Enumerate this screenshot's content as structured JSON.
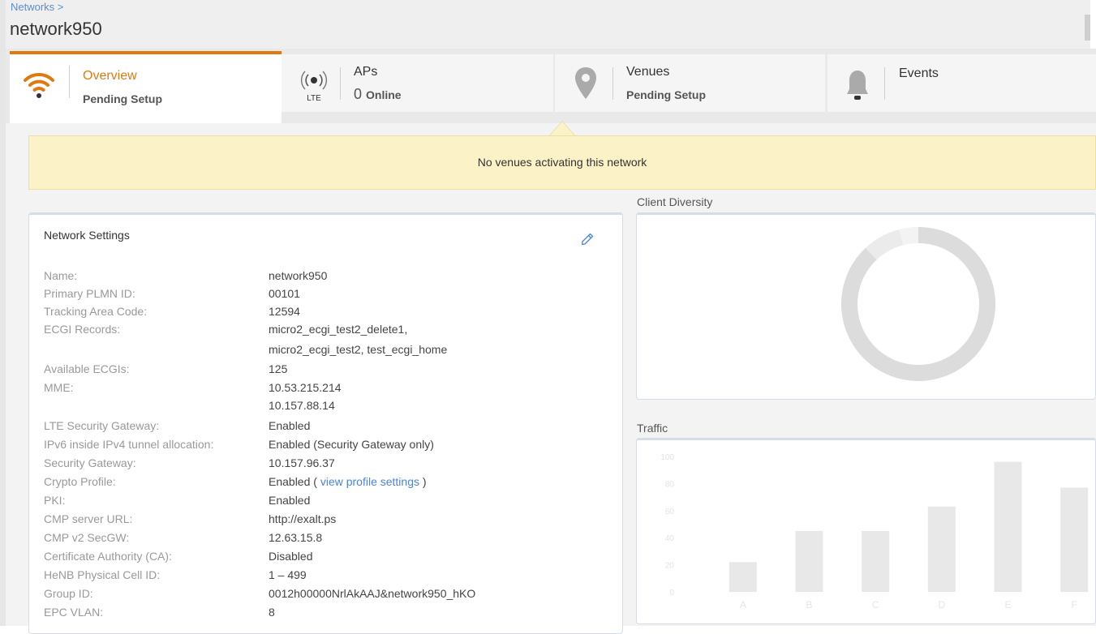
{
  "header": {
    "breadcrumb": "Networks >",
    "title": "network950"
  },
  "tabs": [
    {
      "label": "Overview",
      "sub": "Pending Setup",
      "icon": "wifi-icon",
      "active": true
    },
    {
      "label": "APs",
      "count": "0",
      "count_suffix": "Online",
      "icon": "lte-ap-icon",
      "icon_text": "LTE"
    },
    {
      "label": "Venues",
      "sub": "Pending Setup",
      "icon": "location-pin-icon"
    },
    {
      "label": "Events",
      "icon": "bell-icon"
    }
  ],
  "banner": {
    "text": "No venues activating this network"
  },
  "settings": {
    "title": "Network Settings",
    "rows": [
      {
        "label": "Name:",
        "value": "network950"
      },
      {
        "label": "Primary PLMN ID:",
        "value": "00101"
      },
      {
        "label": "Tracking Area Code:",
        "value": "12594"
      },
      {
        "label": "ECGI Records:",
        "value": "micro2_ecgi_test2_delete1,",
        "value2": "micro2_ecgi_test2, test_ecgi_home"
      },
      {
        "label": "Available ECGIs:",
        "value": "125"
      },
      {
        "label": "MME:",
        "value": "10.53.215.214",
        "value2": "10.157.88.14"
      },
      {
        "label": "LTE Security Gateway:",
        "value": "Enabled"
      },
      {
        "label": "IPv6 inside IPv4 tunnel allocation:",
        "value": "Enabled (Security Gateway only)"
      },
      {
        "label": "Security Gateway:",
        "value": "10.157.96.37"
      },
      {
        "label": "Crypto Profile:",
        "value": "Enabled (",
        "link": "view profile settings",
        "value_after": ")"
      },
      {
        "label": "PKI:",
        "value": "Enabled"
      },
      {
        "label": "CMP server URL:",
        "value": "http://exalt.ps"
      },
      {
        "label": "CMP v2 SecGW:",
        "value": "12.63.15.8"
      },
      {
        "label": "Certificate Authority (CA):",
        "value": "Disabled"
      },
      {
        "label": "HeNB Physical Cell ID:",
        "value": "1 – 499"
      },
      {
        "label": "Group ID:",
        "value": "0012h00000NrlAkAAJ&network950_hKO"
      },
      {
        "label": "EPC VLAN:",
        "value": "8"
      }
    ]
  },
  "client_diversity": {
    "title": "Client Diversity"
  },
  "traffic": {
    "title": "Traffic"
  },
  "chart_data": [
    {
      "type": "pie",
      "title": "Client Diversity",
      "values": [
        88,
        8,
        4
      ],
      "colors": [
        "#dcdcdc",
        "#ebebeb",
        "#f3f3f3"
      ]
    },
    {
      "type": "bar",
      "title": "Traffic",
      "categories": [
        "A",
        "B",
        "C",
        "D",
        "E",
        "F"
      ],
      "values": [
        22,
        45,
        45,
        63,
        96,
        77
      ],
      "ylim": [
        0,
        100
      ],
      "yticks": [
        "0",
        "20",
        "40",
        "60",
        "80",
        "100"
      ],
      "color": "#e8e8e8"
    }
  ]
}
